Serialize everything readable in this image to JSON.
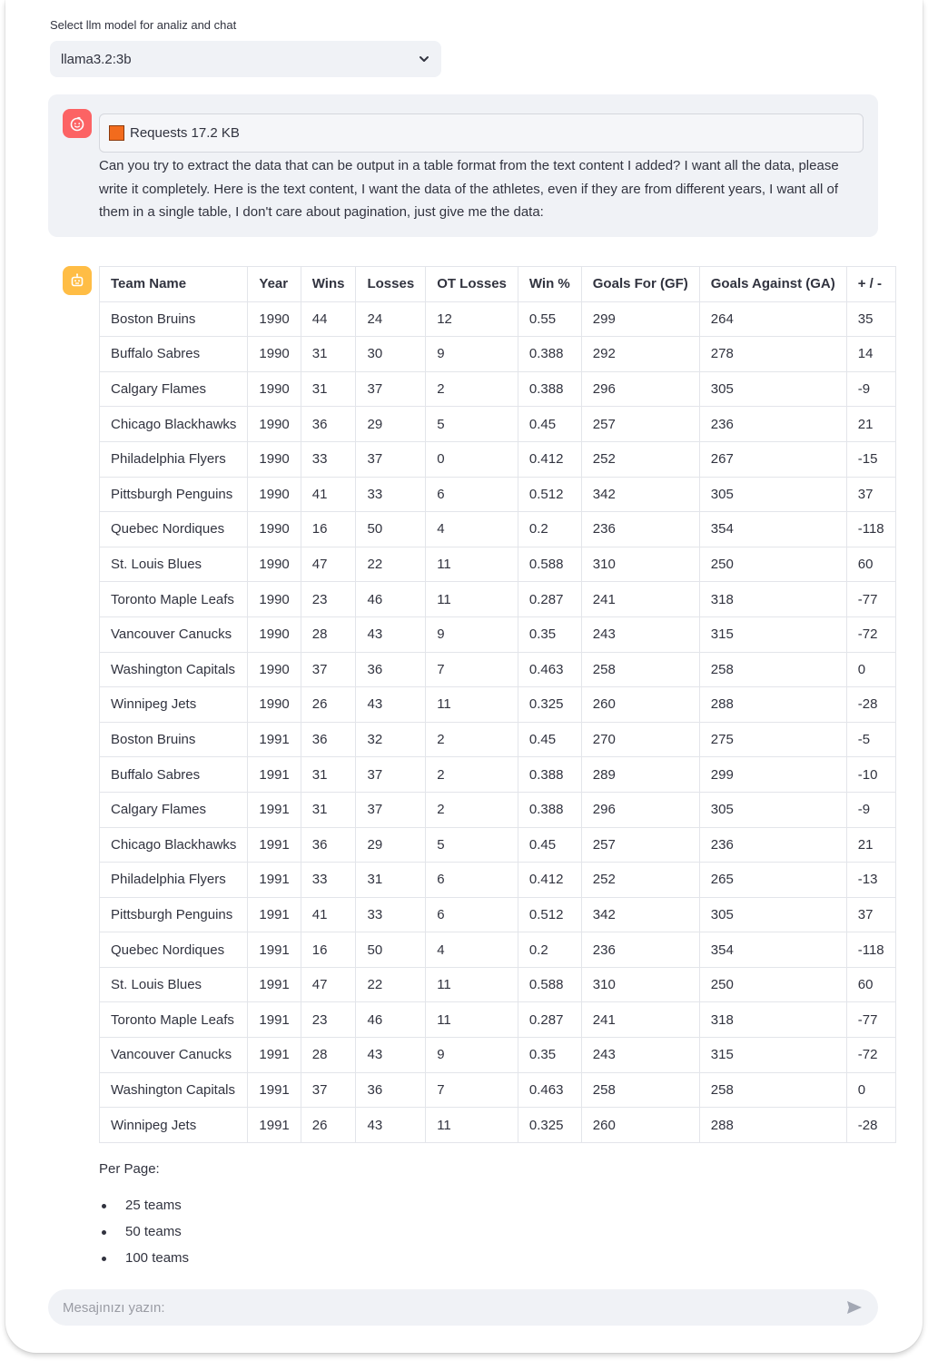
{
  "model_select": {
    "label": "Select llm model for analiz and chat",
    "value": "llama3.2:3b"
  },
  "user_message": {
    "attachment": "Requests 17.2 KB",
    "text": "Can you try to extract the data that can be output in a table format from the text content I added? I want all the data, please write it completely. Here is the text content, I want the data of the athletes, even if they are from different years, I want all of them in a single table, I don't care about pagination, just give me the data:"
  },
  "table": {
    "headers": [
      "Team Name",
      "Year",
      "Wins",
      "Losses",
      "OT Losses",
      "Win %",
      "Goals For (GF)",
      "Goals Against (GA)",
      "+ / -"
    ],
    "rows": [
      [
        "Boston Bruins",
        "1990",
        "44",
        "24",
        "12",
        "0.55",
        "299",
        "264",
        "35"
      ],
      [
        "Buffalo Sabres",
        "1990",
        "31",
        "30",
        "9",
        "0.388",
        "292",
        "278",
        "14"
      ],
      [
        "Calgary Flames",
        "1990",
        "31",
        "37",
        "2",
        "0.388",
        "296",
        "305",
        "-9"
      ],
      [
        "Chicago Blackhawks",
        "1990",
        "36",
        "29",
        "5",
        "0.45",
        "257",
        "236",
        "21"
      ],
      [
        "Philadelphia Flyers",
        "1990",
        "33",
        "37",
        "0",
        "0.412",
        "252",
        "267",
        "-15"
      ],
      [
        "Pittsburgh Penguins",
        "1990",
        "41",
        "33",
        "6",
        "0.512",
        "342",
        "305",
        "37"
      ],
      [
        "Quebec Nordiques",
        "1990",
        "16",
        "50",
        "4",
        "0.2",
        "236",
        "354",
        "-118"
      ],
      [
        "St. Louis Blues",
        "1990",
        "47",
        "22",
        "11",
        "0.588",
        "310",
        "250",
        "60"
      ],
      [
        "Toronto Maple Leafs",
        "1990",
        "23",
        "46",
        "11",
        "0.287",
        "241",
        "318",
        "-77"
      ],
      [
        "Vancouver Canucks",
        "1990",
        "28",
        "43",
        "9",
        "0.35",
        "243",
        "315",
        "-72"
      ],
      [
        "Washington Capitals",
        "1990",
        "37",
        "36",
        "7",
        "0.463",
        "258",
        "258",
        "0"
      ],
      [
        "Winnipeg Jets",
        "1990",
        "26",
        "43",
        "11",
        "0.325",
        "260",
        "288",
        "-28"
      ],
      [
        "Boston Bruins",
        "1991",
        "36",
        "32",
        "2",
        "0.45",
        "270",
        "275",
        "-5"
      ],
      [
        "Buffalo Sabres",
        "1991",
        "31",
        "37",
        "2",
        "0.388",
        "289",
        "299",
        "-10"
      ],
      [
        "Calgary Flames",
        "1991",
        "31",
        "37",
        "2",
        "0.388",
        "296",
        "305",
        "-9"
      ],
      [
        "Chicago Blackhawks",
        "1991",
        "36",
        "29",
        "5",
        "0.45",
        "257",
        "236",
        "21"
      ],
      [
        "Philadelphia Flyers",
        "1991",
        "33",
        "31",
        "6",
        "0.412",
        "252",
        "265",
        "-13"
      ],
      [
        "Pittsburgh Penguins",
        "1991",
        "41",
        "33",
        "6",
        "0.512",
        "342",
        "305",
        "37"
      ],
      [
        "Quebec Nordiques",
        "1991",
        "16",
        "50",
        "4",
        "0.2",
        "236",
        "354",
        "-118"
      ],
      [
        "St. Louis Blues",
        "1991",
        "47",
        "22",
        "11",
        "0.588",
        "310",
        "250",
        "60"
      ],
      [
        "Toronto Maple Leafs",
        "1991",
        "23",
        "46",
        "11",
        "0.287",
        "241",
        "318",
        "-77"
      ],
      [
        "Vancouver Canucks",
        "1991",
        "28",
        "43",
        "9",
        "0.35",
        "243",
        "315",
        "-72"
      ],
      [
        "Washington Capitals",
        "1991",
        "37",
        "36",
        "7",
        "0.463",
        "258",
        "258",
        "0"
      ],
      [
        "Winnipeg Jets",
        "1991",
        "26",
        "43",
        "11",
        "0.325",
        "260",
        "288",
        "-28"
      ]
    ]
  },
  "per_page": {
    "label": "Per Page:",
    "options": [
      "25 teams",
      "50 teams",
      "100 teams"
    ]
  },
  "chat_input": {
    "placeholder": "Mesajınızı yazın:"
  },
  "icons": {
    "user_avatar": "smiley-face-icon",
    "bot_avatar": "robot-icon",
    "select": "chevron-down-icon",
    "send": "send-arrow-icon",
    "attachment": "orange-square-icon"
  },
  "colors": {
    "user_avatar": "#ff4b4b",
    "bot_avatar": "#ffbd45",
    "attachment_square": "#f26b1d"
  }
}
